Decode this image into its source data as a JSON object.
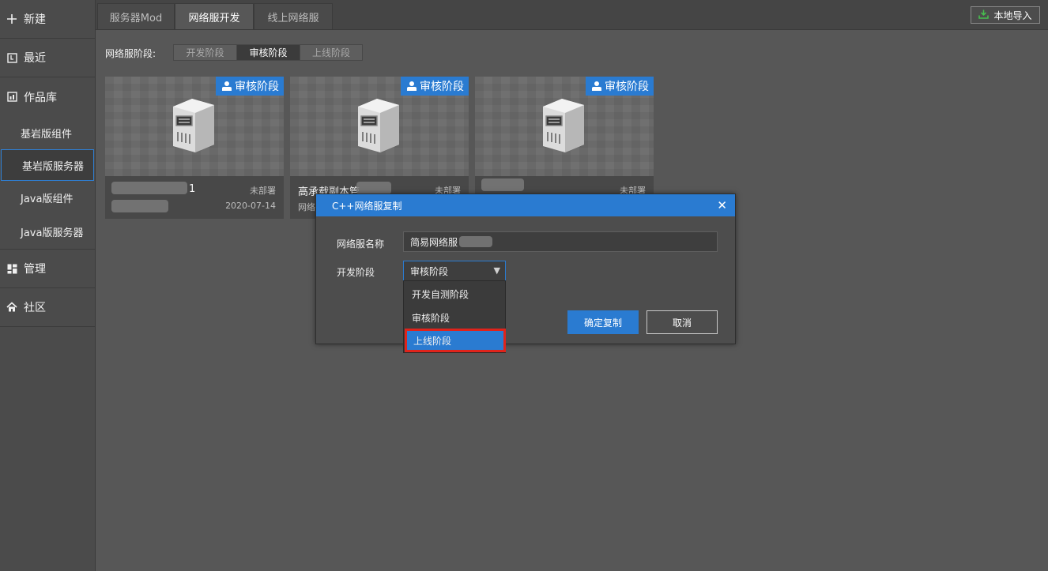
{
  "sidebar": {
    "new": "新建",
    "recent": "最近",
    "library": "作品库",
    "sub_items": [
      "基岩版组件",
      "基岩版服务器",
      "Java版组件",
      "Java版服务器"
    ],
    "manage": "管理",
    "community": "社区"
  },
  "tabs": [
    "服务器Mod",
    "网络服开发",
    "线上网络服"
  ],
  "import_button": "本地导入",
  "stage_filter": {
    "label": "网络服阶段:",
    "options": [
      "开发阶段",
      "审核阶段",
      "上线阶段"
    ],
    "selected": "审核阶段"
  },
  "cards": [
    {
      "badge": "审核阶段",
      "title": "1",
      "status": "未部署",
      "date": "2020-07-14",
      "sub": ""
    },
    {
      "badge": "审核阶段",
      "title": "高承载副本管",
      "status": "未部署",
      "date": "",
      "sub": "网络"
    },
    {
      "badge": "审核阶段",
      "title": "",
      "status": "未部署",
      "date": "",
      "sub": ""
    }
  ],
  "dialog": {
    "title": "C++网络服复制",
    "name_label": "网络服名称",
    "name_value": "简易网络服",
    "stage_label": "开发阶段",
    "stage_value": "审核阶段",
    "options": [
      "开发自测阶段",
      "审核阶段",
      "上线阶段"
    ],
    "highlighted_option": "上线阶段",
    "confirm": "确定复制",
    "cancel": "取消"
  },
  "colors": {
    "accent": "#2a7bd1",
    "highlight_border": "#e0231b",
    "import_icon": "#47c04e"
  }
}
